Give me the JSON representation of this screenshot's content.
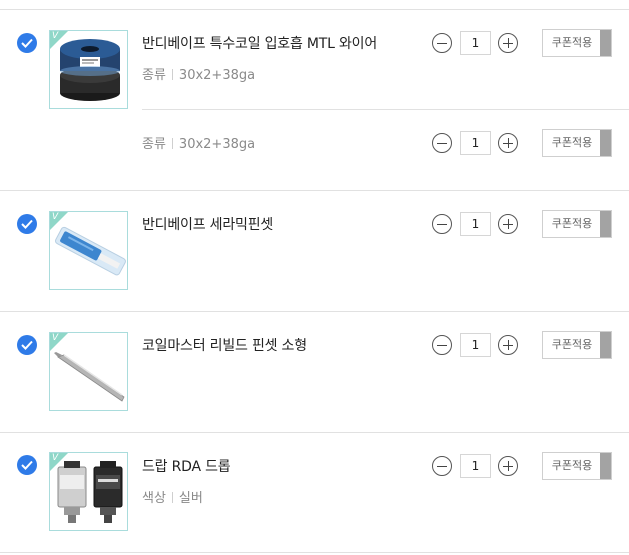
{
  "items": [
    {
      "name": "반디베이프 특수코일 입호흡 MTL 와이어",
      "options": [
        {
          "label": "종류",
          "value": "30x2+38ga",
          "quantity": "1",
          "coupon_label": "쿠폰적용"
        },
        {
          "label": "종류",
          "value": "30x2+38ga",
          "quantity": "1",
          "coupon_label": "쿠폰적용"
        }
      ]
    },
    {
      "name": "반디베이프 세라믹핀셋",
      "quantity": "1",
      "coupon_label": "쿠폰적용"
    },
    {
      "name": "코일마스터 리빌드 핀셋 소형",
      "quantity": "1",
      "coupon_label": "쿠폰적용"
    },
    {
      "name": "드랍 RDA 드롭",
      "options": [
        {
          "label": "색상",
          "value": "실버",
          "quantity": "1",
          "coupon_label": "쿠폰적용"
        }
      ]
    }
  ],
  "badge_letter": "V",
  "colors": {
    "check": "#2f7be8",
    "badge": "#8fd7c8",
    "thumb_border": "#a9dcdc",
    "coupon_bar": "#a3a3a3"
  }
}
